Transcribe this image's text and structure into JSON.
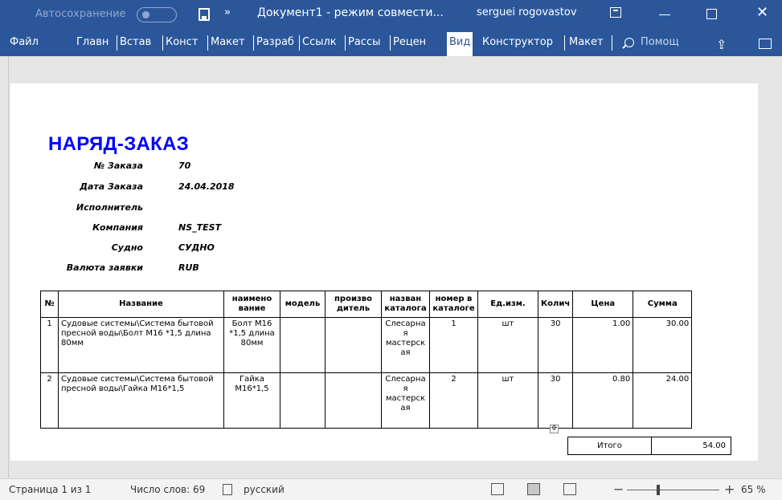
{
  "titlebar": {
    "autosave_label": "Автосохранение",
    "autosave_state": "off",
    "more_glyph": "»",
    "doc_title": "Документ1  -  режим совмести...",
    "user_name": "serguei rogovastov",
    "close_glyph": "✕",
    "accent_color": "#2b579a"
  },
  "ribbon": {
    "tabs": [
      {
        "label": "Файл"
      },
      {
        "label": "Главн"
      },
      {
        "label": "Встав"
      },
      {
        "label": "Конст"
      },
      {
        "label": "Макет"
      },
      {
        "label": "Разраб"
      },
      {
        "label": "Ссылк"
      },
      {
        "label": "Рассы"
      },
      {
        "label": "Рецен"
      },
      {
        "label": "Вид"
      },
      {
        "label": "Конструктор"
      },
      {
        "label": "Макет"
      }
    ],
    "active_tab": "Вид",
    "help_label": "Помощ",
    "share_glyph": "⇪"
  },
  "document": {
    "heading": "НАРЯД-ЗАКАЗ",
    "fields": [
      {
        "label": "№ Заказа",
        "value": "70"
      },
      {
        "label": "Дата Заказа",
        "value": "24.04.2018"
      },
      {
        "label": "Исполнитель",
        "value": ""
      },
      {
        "label": "Компания",
        "value": "NS_TEST"
      },
      {
        "label": "Судно",
        "value": "СУДНО"
      },
      {
        "label": "Валюта заявки",
        "value": "RUB"
      }
    ],
    "table": {
      "columns": [
        "№",
        "Название",
        "наимено вание",
        "модель",
        "произво дитель",
        "назван каталога",
        "номер в каталоге",
        "Ед.изм.",
        "Колич",
        "Цена",
        "Сумма"
      ],
      "rows": [
        [
          "1",
          "Судовые системы\\Система бытовой пресной воды\\Болт М16 *1,5 длина 80мм",
          "Болт М16 *1,5 длина 80мм",
          "",
          "",
          "Слесарна я мастерск ая",
          "1",
          "шт",
          "30",
          "1.00",
          "30.00"
        ],
        [
          "2",
          "Судовые системы\\Система бытовой пресной воды\\Гайка М16*1,5",
          "Гайка М16*1,5",
          "",
          "",
          "Слесарна я мастерск ая",
          "2",
          "шт",
          "30",
          "0.80",
          "24.00"
        ]
      ]
    },
    "total": {
      "label": "Итого",
      "value": "54.00"
    },
    "move_handle_glyph": "✥"
  },
  "statusbar": {
    "page_info": "Страница 1 из 1",
    "word_count": "Число слов: 69",
    "language": "русский",
    "zoom_minus": "−",
    "zoom_plus": "+",
    "zoom_level": "65 %",
    "zoom_percent": 65
  }
}
